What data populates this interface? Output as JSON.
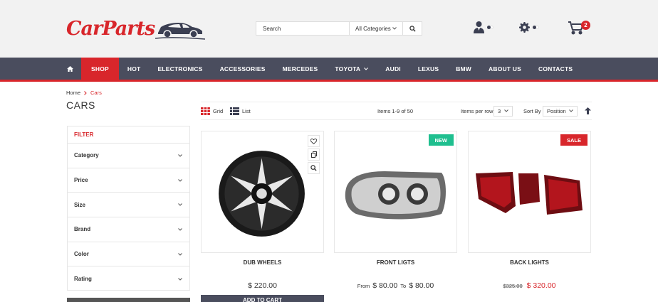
{
  "brand": {
    "logo": "CarParts"
  },
  "search": {
    "placeholder": "Search",
    "category": "All Categories"
  },
  "cart": {
    "count": "2"
  },
  "nav": {
    "items": [
      "SHOP",
      "HOT",
      "ELECTRONICS",
      "ACCESSORIES",
      "MERCEDES",
      "TOYOTA",
      "AUDI",
      "LEXUS",
      "BMW",
      "ABOUT US",
      "CONTACTS"
    ]
  },
  "breadcrumb": {
    "home": "Home",
    "current": "Cars"
  },
  "page": {
    "title": "CARS"
  },
  "filter": {
    "title": "FILTER",
    "items": [
      "Category",
      "Price",
      "Size",
      "Brand",
      "Color",
      "Rating"
    ]
  },
  "toolbar": {
    "grid": "Grid",
    "list": "List",
    "items_info": "Items 1-9 of 50",
    "per_row_label": "Items per row",
    "per_row_value": "3",
    "sort_label": "Sort By",
    "sort_value": "Position"
  },
  "products": [
    {
      "name": "DUB WHEELS",
      "price": "$ 220.00",
      "cta": "ADD TO CART"
    },
    {
      "name": "FRONT LIGTS",
      "tag": "NEW",
      "from_label": "From",
      "price_from": "$ 80.00",
      "to_label": "To",
      "price_to": "$ 80.00"
    },
    {
      "name": "BACK LIGHTS",
      "tag": "SALE",
      "old_price": "$325.00",
      "price": "$ 320.00"
    }
  ],
  "colors": {
    "accent": "#d8262b",
    "nav_bg": "#4a4d5e",
    "new_tag": "#1fbf8f"
  }
}
